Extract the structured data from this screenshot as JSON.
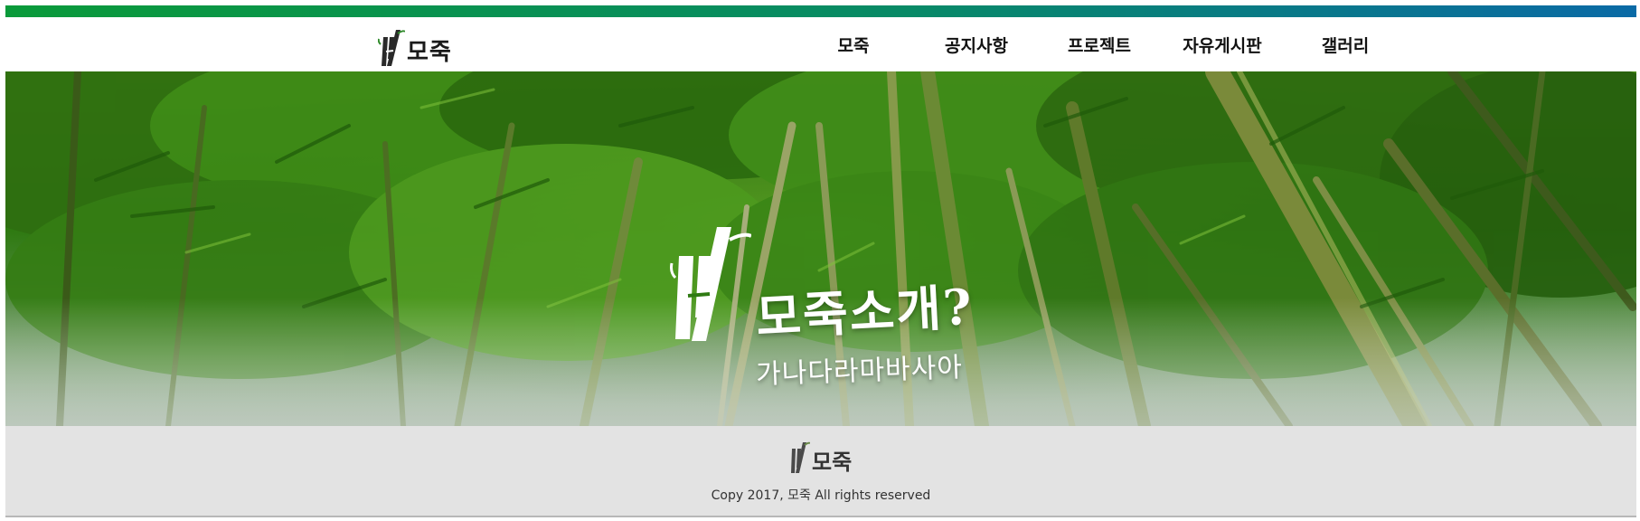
{
  "brand": {
    "name": "모죽",
    "colors": {
      "stripe_start": "#0a9a3a",
      "stripe_end": "#0a6aa6",
      "footer_bg": "#e3e3e3"
    }
  },
  "nav": {
    "items": [
      {
        "label": "모죽"
      },
      {
        "label": "공지사항"
      },
      {
        "label": "프로젝트"
      },
      {
        "label": "자유게시판"
      },
      {
        "label": "갤러리"
      }
    ]
  },
  "hero": {
    "title": "모죽소개?",
    "subtitle": "가나다라마바사아",
    "background": "bamboo-forest-photo"
  },
  "footer": {
    "logo_text": "모죽",
    "copyright": "Copy 2017, 모죽 All rights reserved"
  }
}
